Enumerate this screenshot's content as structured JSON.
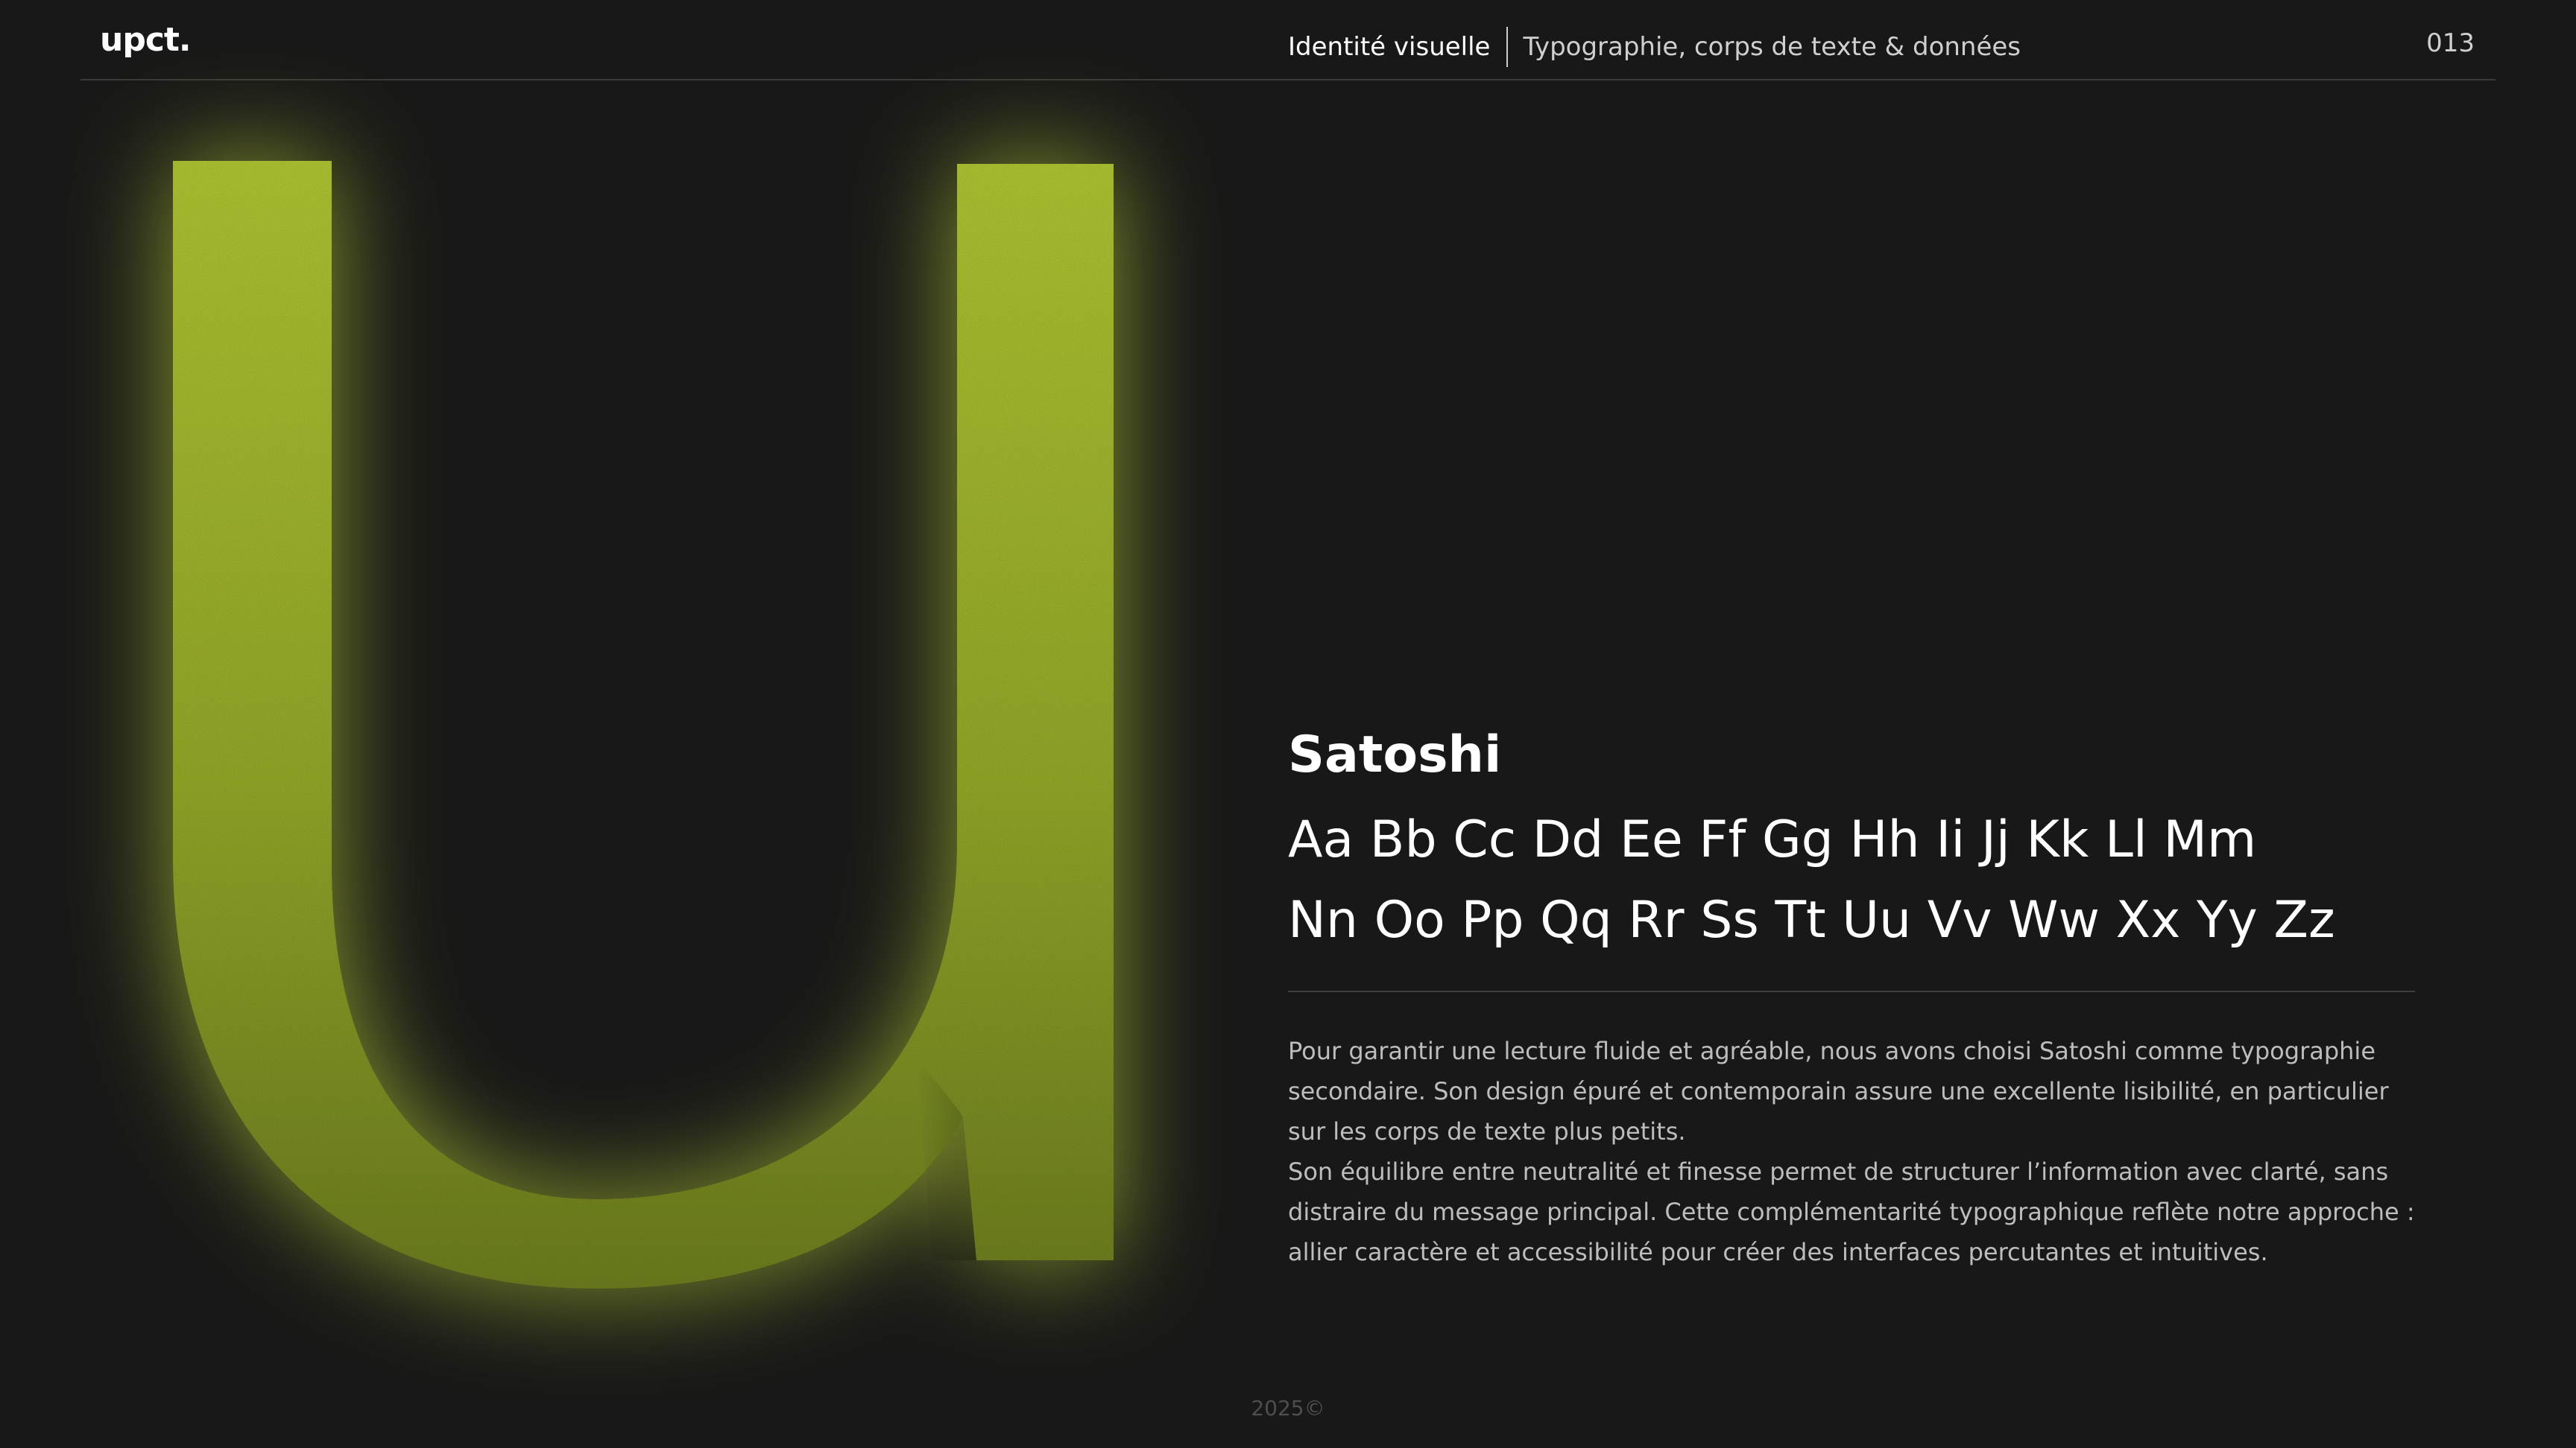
{
  "header": {
    "logo": "upct.",
    "section": "Identité visuelle",
    "page_title": "Typographie, corps de texte & données",
    "page_number": "013"
  },
  "glyph": {
    "letter": "u",
    "color": "#b3c735"
  },
  "font": {
    "name": "Satoshi",
    "alphabet_line_1": "Aa Bb Cc Dd Ee Ff Gg Hh Ii Jj Kk Ll Mm",
    "alphabet_line_2": "Nn Oo Pp Qq Rr Ss Tt Uu Vv Ww Xx Yy Zz"
  },
  "description": {
    "paragraph_1": "Pour garantir une lecture fluide et agréable, nous avons choisi Satoshi comme typographie secondaire. Son design épuré et contemporain assure une excellente lisibilité, en particulier sur les corps de texte plus petits.",
    "paragraph_2": "Son équilibre entre neutralité et finesse permet de structurer l’information avec clarté, sans distraire du message principal. Cette complémentarité typographique reflète notre approche : allier caractère et accessibilité pour créer des interfaces percutantes et intuitives."
  },
  "footer": {
    "copyright": "2025©"
  }
}
